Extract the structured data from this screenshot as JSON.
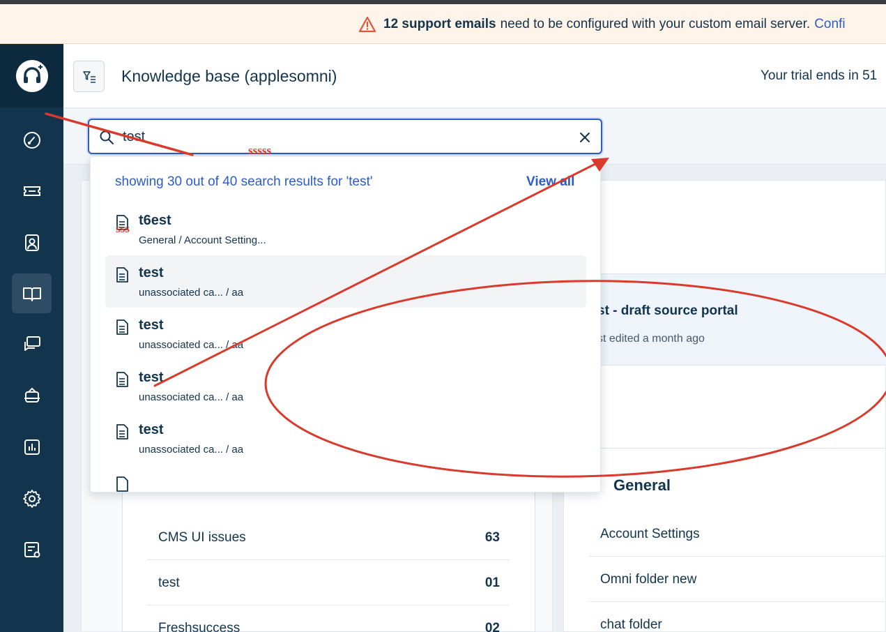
{
  "banner": {
    "count_text": "12 support emails",
    "middle_text": "need to be configured with your custom email server.",
    "link_text": "Confi"
  },
  "header": {
    "title": "Knowledge base (applesomni)",
    "trial_text": "Your trial ends in 51"
  },
  "search": {
    "value": "test"
  },
  "dropdown": {
    "summary": "showing 30 out of 40 search results for 'test'",
    "view_all": "View all",
    "results": [
      {
        "title": "t6est",
        "path": "General / Account Setting..."
      },
      {
        "title": "test",
        "path": "unassociated ca... / aa"
      },
      {
        "title": "test",
        "path": "unassociated ca... / aa"
      },
      {
        "title": "test",
        "path": "unassociated ca... / aa"
      },
      {
        "title": "test",
        "path": "unassociated ca... / aa"
      }
    ]
  },
  "categories": [
    {
      "name": "CMS UI issues",
      "count": "63"
    },
    {
      "name": "test",
      "count": "01"
    },
    {
      "name": "Freshsuccess",
      "count": "02"
    }
  ],
  "draft": {
    "title": "st - draft source portal",
    "subtitle": "st edited a month ago"
  },
  "general": {
    "title": "General",
    "folders": [
      "Account Settings",
      "Omni folder new",
      "chat folder"
    ]
  },
  "annotations": {
    "scribble_1": "sssss",
    "scribble_2": "sss"
  },
  "colors": {
    "sidebar": "#12344d",
    "accent": "#2c5cc5",
    "annotation": "#d93a2b",
    "warning": "#e0533c"
  }
}
